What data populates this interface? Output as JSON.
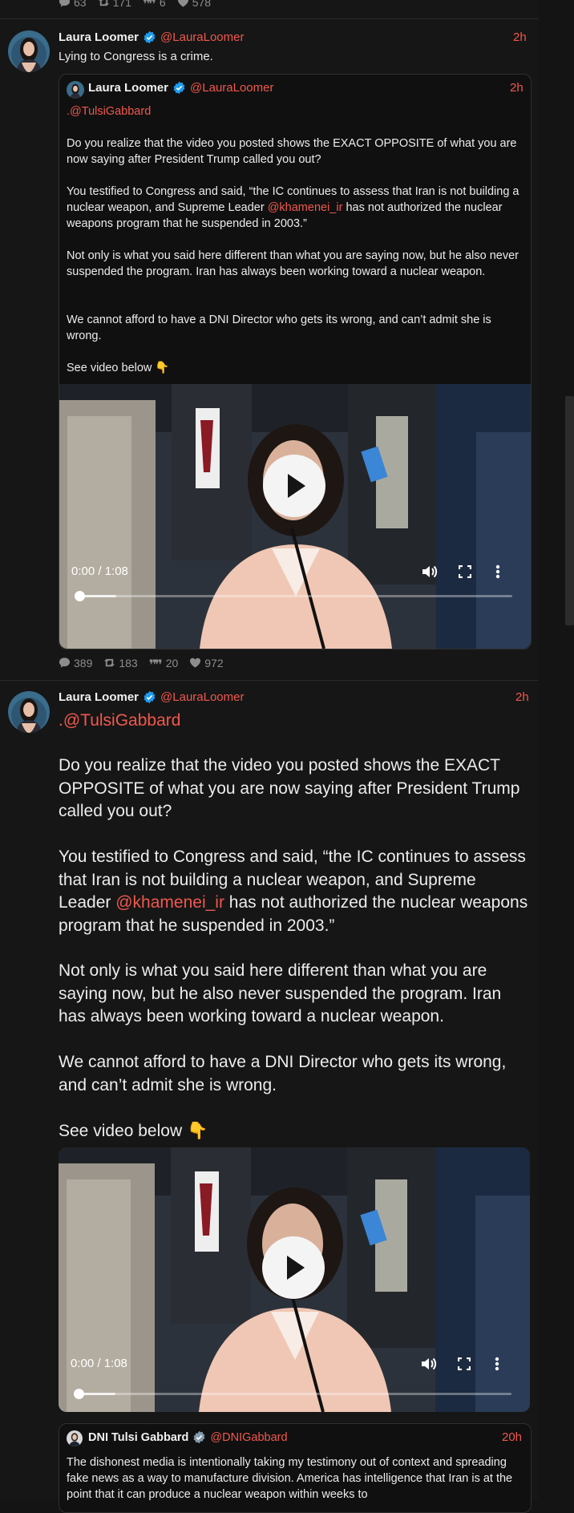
{
  "colors": {
    "background": "#161616",
    "accent": "#f0584d",
    "verified": "#1d9bf0",
    "muted": "#8d8d8d"
  },
  "top_stats": {
    "replies": "63",
    "retweets": "171",
    "quotes": "6",
    "likes": "578"
  },
  "post1": {
    "author": {
      "name": "Laura Loomer",
      "handle": "@LauraLoomer",
      "time": "2h",
      "verified_icon": "verified-badge-icon"
    },
    "text": "Lying to Congress is a crime.",
    "quoted": {
      "author": {
        "name": "Laura Loomer",
        "handle": "@LauraLoomer",
        "time": "2h"
      },
      "mention": ".@TulsiGabbard",
      "p1": "Do you realize that the video you posted shows the EXACT OPPOSITE of what you are now saying after President Trump called you out?",
      "p2_before": "You testified to Congress and said, “the IC continues to assess that Iran is not building a nuclear weapon, and Supreme Leader ",
      "p2_mention": "@khamenei_ir",
      "p2_after": " has not authorized the nuclear weapons program that he suspended in 2003.”",
      "p3": "Not only is what you said here different than what you are saying now, but he also never suspended the program. Iran has always been working toward a nuclear weapon.",
      "p4": "We cannot afford to have a DNI Director who gets its wrong, and can’t admit she is wrong.",
      "p5": "See video below 👇",
      "video": {
        "time": "0:00 / 1:08",
        "progress": 0
      }
    },
    "stats": {
      "replies": "389",
      "retweets": "183",
      "quotes": "20",
      "likes": "972"
    }
  },
  "post2": {
    "author": {
      "name": "Laura Loomer",
      "handle": "@LauraLoomer",
      "time": "2h"
    },
    "mention": ".@TulsiGabbard",
    "p1": "Do you realize that the video you posted shows the EXACT OPPOSITE of what you are now saying after President Trump called you out?",
    "p2_before": "You testified to Congress and said, “the IC continues to assess that Iran is not building a nuclear weapon, and Supreme Leader ",
    "p2_mention": "@khamenei_ir",
    "p2_after": " has not authorized the nuclear weapons program that he suspended in 2003.”",
    "p3": "Not only is what you said here different than what you are saying now, but he also never suspended the program. Iran has always been working toward a nuclear weapon.",
    "p4": "We cannot afford to have a DNI Director who gets its wrong, and can’t admit she is wrong.",
    "p5": "See video below 👇",
    "video": {
      "time": "0:00 / 1:08",
      "progress": 0
    },
    "quoted": {
      "author": {
        "name": "DNI Tulsi Gabbard",
        "handle": "@DNIGabbard",
        "time": "20h",
        "verified_icon": "gray-verified-badge-icon"
      },
      "text": "The dishonest media is intentionally taking my testimony out of context and spreading fake news as a way to manufacture division. America has intelligence that Iran is at the point that it can produce a nuclear weapon within weeks to"
    }
  }
}
